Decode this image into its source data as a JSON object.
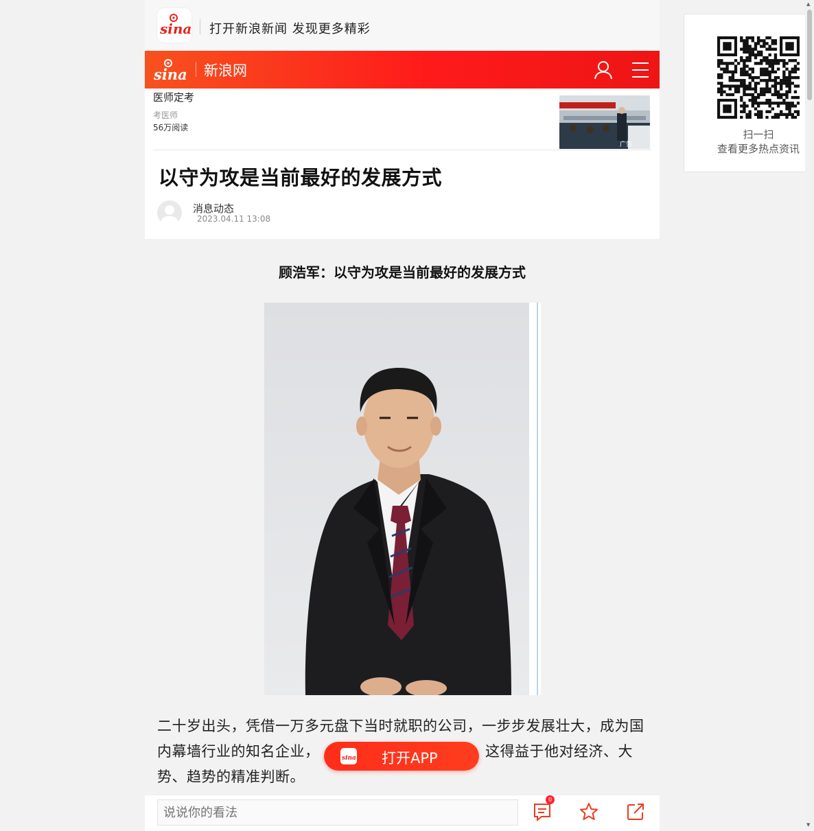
{
  "banner": {
    "text": "打开新浪新闻 发现更多精彩"
  },
  "header": {
    "site_name": "新浪网"
  },
  "ad": {
    "title": "医师定考",
    "source": "考医师",
    "reads": "56万阅读",
    "image_text": "广告"
  },
  "article": {
    "title": "以守为攻是当前最好的发展方式",
    "author": "消息动态",
    "date": "2023.04.11 13:08",
    "subtitle": "顾浩军：以守为攻是当前最好的发展方式",
    "paragraph_visible": "二十岁出头，凭借一万多元盘下当时就职的公司，一步步发展壮大，成为国内幕墙行业的知名企业，",
    "paragraph_end": "，这得益于他对经济、大势、趋势的精准判断。"
  },
  "open_app": {
    "label": "打开APP"
  },
  "bottom_bar": {
    "comment_placeholder": "说说你的看法",
    "comment_count": "0"
  },
  "qr_card": {
    "line1": "扫一扫",
    "line2": "查看更多热点资讯"
  },
  "colors": {
    "brand_red": "#ff1a1a",
    "brand_orange": "#f7521e",
    "icon_accent": "#ee3a1e"
  }
}
